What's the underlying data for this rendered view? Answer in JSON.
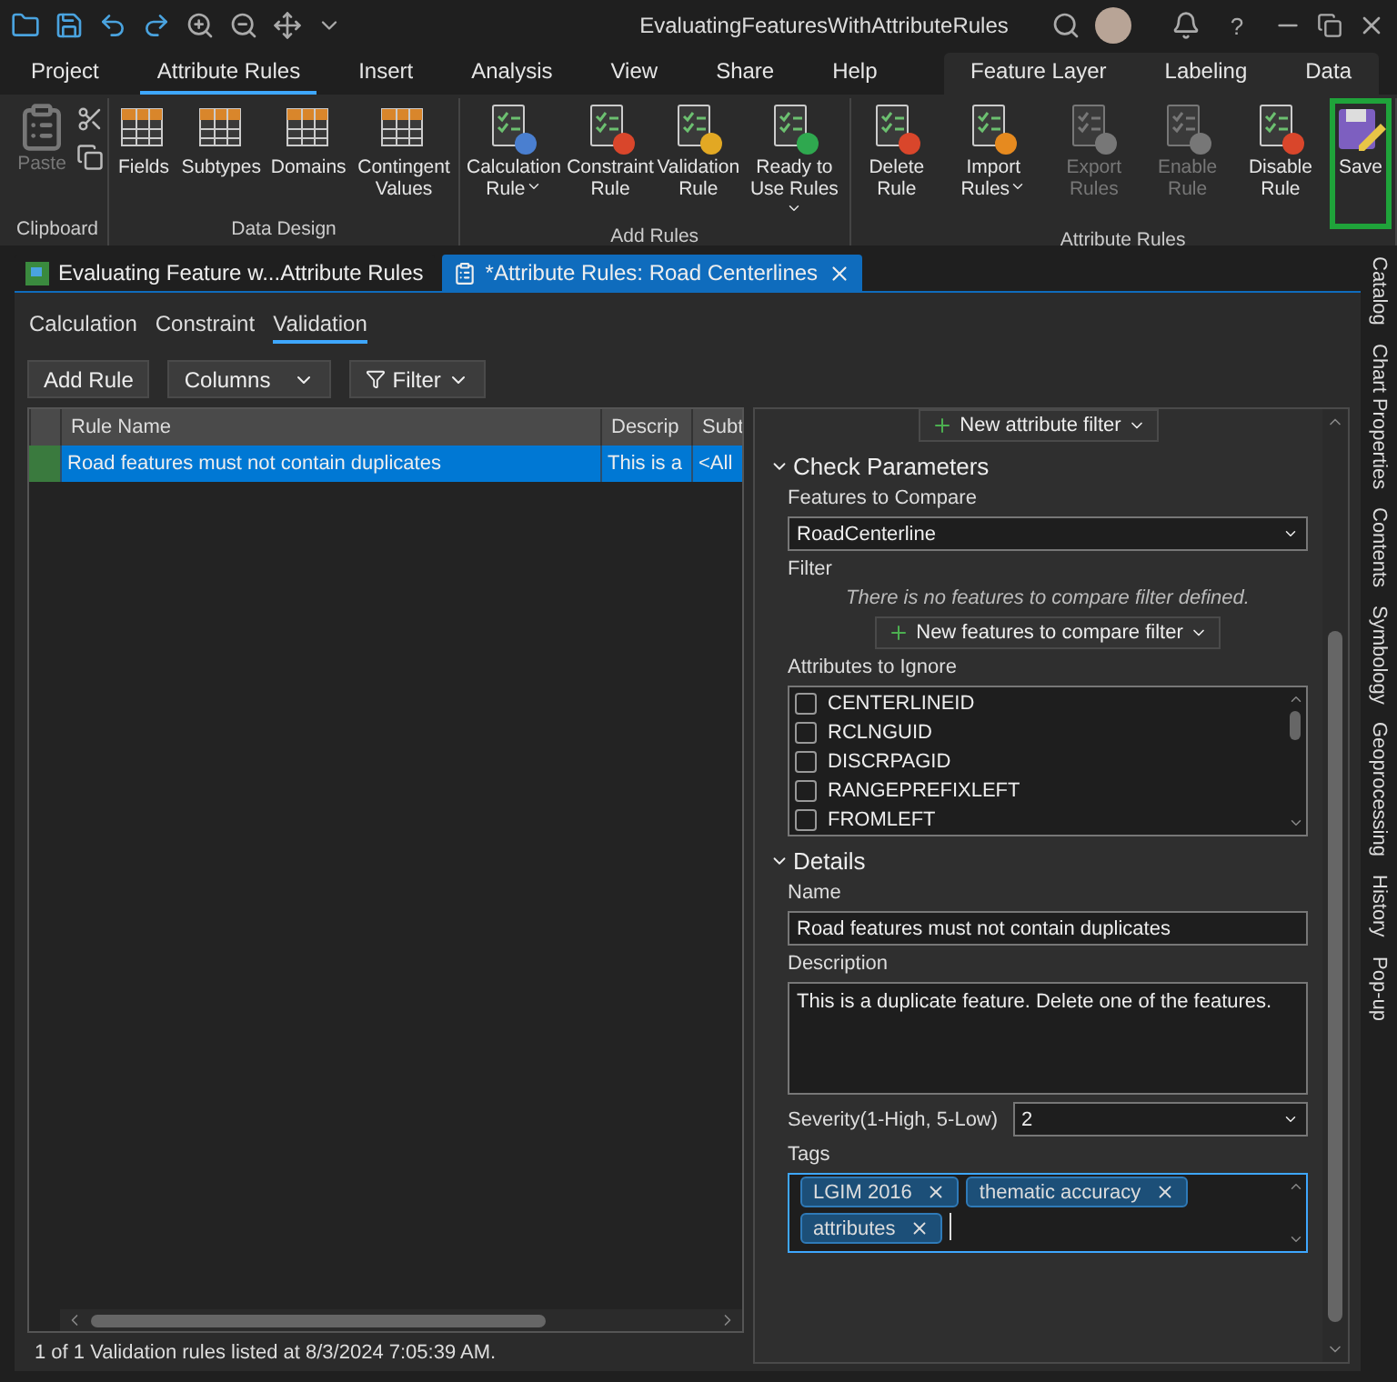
{
  "title_bar": {
    "title": "EvaluatingFeaturesWithAttributeRules",
    "help": "?"
  },
  "ribbon_tabs": [
    {
      "label": "Project",
      "selected": false,
      "kind": "main"
    },
    {
      "label": "Attribute Rules",
      "selected": true,
      "kind": "main"
    },
    {
      "label": "Insert",
      "selected": false,
      "kind": "main"
    },
    {
      "label": "Analysis",
      "selected": false,
      "kind": "main"
    },
    {
      "label": "View",
      "selected": false,
      "kind": "main"
    },
    {
      "label": "Share",
      "selected": false,
      "kind": "main"
    },
    {
      "label": "Help",
      "selected": false,
      "kind": "main"
    },
    {
      "label": "Feature Layer",
      "selected": false,
      "kind": "contextual"
    },
    {
      "label": "Labeling",
      "selected": false,
      "kind": "contextual"
    },
    {
      "label": "Data",
      "selected": false,
      "kind": "contextual"
    }
  ],
  "ribbon_groups": [
    {
      "label": "Clipboard",
      "buttons": [
        {
          "kind": "large",
          "label": "Paste",
          "disabled": true
        },
        {
          "kind": "small",
          "disabled": false
        },
        {
          "kind": "small",
          "disabled": false
        }
      ]
    },
    {
      "label": "Data Design",
      "buttons": [
        {
          "kind": "large",
          "label": "Fields",
          "disabled": false
        },
        {
          "kind": "large",
          "label": "Subtypes",
          "disabled": false
        },
        {
          "kind": "large",
          "label": "Domains",
          "disabled": false
        },
        {
          "kind": "large",
          "label": "Contingent Values",
          "disabled": false
        }
      ]
    },
    {
      "label": "Add Rules",
      "buttons": [
        {
          "kind": "large",
          "label": "Calculation Rule",
          "disabled": false,
          "dropdown": true
        },
        {
          "kind": "large",
          "label": "Constraint Rule",
          "disabled": false
        },
        {
          "kind": "large",
          "label": "Validation Rule",
          "disabled": false
        },
        {
          "kind": "large",
          "label": "Ready to Use Rules",
          "disabled": false,
          "dropdown": true
        }
      ]
    },
    {
      "label": "Attribute Rules",
      "buttons": [
        {
          "kind": "large",
          "label": "Delete Rule",
          "disabled": false
        },
        {
          "kind": "large",
          "label": "Import Rules",
          "disabled": false,
          "dropdown": true
        },
        {
          "kind": "large",
          "label": "Export Rules",
          "disabled": true
        },
        {
          "kind": "large",
          "label": "Enable Rule",
          "disabled": true
        },
        {
          "kind": "large",
          "label": "Disable Rule",
          "disabled": false
        },
        {
          "kind": "large",
          "label": "Save",
          "disabled": false,
          "highlighted": true
        }
      ]
    }
  ],
  "document_tabs": [
    {
      "label": "Evaluating Feature w...Attribute Rules",
      "selected": false
    },
    {
      "label": "*Attribute Rules: Road Centerlines",
      "selected": true
    }
  ],
  "rule_type_tabs": [
    {
      "label": "Calculation",
      "selected": false
    },
    {
      "label": "Constraint",
      "selected": false
    },
    {
      "label": "Validation",
      "selected": true
    }
  ],
  "toolbar": [
    {
      "label": "Add Rule",
      "kind": "button"
    },
    {
      "label": "Columns",
      "kind": "dropdown"
    },
    {
      "label": "Filter",
      "kind": "filter"
    }
  ],
  "rules_table": {
    "columns": [
      "Rule Name",
      "Descrip",
      "Subt"
    ],
    "rows": [
      {
        "cells": [
          "Road features must not contain duplicates",
          "This is a",
          "<All"
        ],
        "selected": true
      }
    ]
  },
  "status": "1 of 1 Validation rules listed at 8/3/2024 7:05:39 AM.",
  "rule_panel": {
    "attribute_filter_button": "New attribute filter",
    "check_parameters": {
      "title": "Check Parameters",
      "expanded": true,
      "features_label": "Features to Compare",
      "features_value": "RoadCenterline",
      "filter_label": "Filter",
      "filter_note": "There is no features to compare filter defined.",
      "filter_button": "New features to compare filter",
      "ignore_label": "Attributes to Ignore",
      "attributes": [
        {
          "name": "CENTERLINEID",
          "checked": false
        },
        {
          "name": "RCLNGUID",
          "checked": false
        },
        {
          "name": "DISCRPAGID",
          "checked": false
        },
        {
          "name": "RANGEPREFIXLEFT",
          "checked": false
        },
        {
          "name": "FROMLEFT",
          "checked": false
        }
      ]
    },
    "details": {
      "title": "Details",
      "expanded": true,
      "name_label": "Name",
      "name_value": "Road features must not contain duplicates",
      "description_label": "Description",
      "description_value": "This is a duplicate feature. Delete one of the features.",
      "severity_label": "Severity(1-High, 5-Low)",
      "severity_value": "2",
      "tags_label": "Tags",
      "tags": [
        "LGIM 2016",
        "thematic accuracy",
        "attributes"
      ]
    }
  },
  "dock_tabs": [
    "Catalog",
    "Chart Properties",
    "Contents",
    "Symbology",
    "Geoprocessing",
    "History",
    "Pop-up"
  ]
}
